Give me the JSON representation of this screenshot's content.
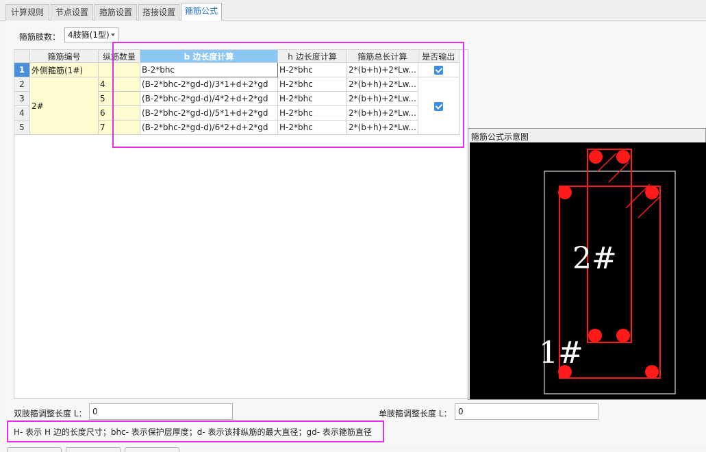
{
  "tabs": [
    {
      "label": "计算规则"
    },
    {
      "label": "节点设置"
    },
    {
      "label": "箍筋设置"
    },
    {
      "label": "搭接设置"
    },
    {
      "label": "箍筋公式"
    }
  ],
  "stirrup_legs": {
    "label": "箍筋肢数：",
    "value": "4肢箍(1型)"
  },
  "table": {
    "headers": [
      "箍筋编号",
      "纵筋数量",
      "b 边长度计算",
      "h 边长度计算",
      "箍筋总长计算",
      "是否输出"
    ],
    "row_numbers": [
      "1",
      "2",
      "3",
      "4",
      "5"
    ],
    "rows": [
      {
        "id": "外侧箍筋(1#)",
        "count": "",
        "b": "B-2*bhc",
        "h": "H-2*bhc",
        "total": "2*(b+h)+2*Lw..."
      },
      {
        "id": "2#",
        "count": "4",
        "b": "(B-2*bhc-2*gd-d)/3*1+d+2*gd",
        "h": "H-2*bhc",
        "total": "2*(b+h)+2*Lw..."
      },
      {
        "id": "",
        "count": "5",
        "b": "(B-2*bhc-2*gd-d)/4*2+d+2*gd",
        "h": "H-2*bhc",
        "total": "2*(b+h)+2*Lw..."
      },
      {
        "id": "",
        "count": "6",
        "b": "(B-2*bhc-2*gd-d)/5*1+d+2*gd",
        "h": "H-2*bhc",
        "total": "2*(b+h)+2*Lw..."
      },
      {
        "id": "",
        "count": "7",
        "b": "(B-2*bhc-2*gd-d)/6*2+d+2*gd",
        "h": "H-2*bhc",
        "total": "2*(b+h)+2*Lw..."
      }
    ]
  },
  "diagram": {
    "title": "箍筋公式示意图",
    "label_outer": "1#",
    "label_inner": "2#"
  },
  "double_leg": {
    "label": "双肢箍调整长度 L：",
    "value": "0"
  },
  "single_leg": {
    "label": "单肢箍调整长度 L：",
    "value": "0"
  },
  "legend": "H- 表示 H 边的长度尺寸；bhc- 表示保护层厚度；d- 表示该排纵筋的最大直径；gd- 表示箍筋直径",
  "colors": {
    "accent": "#1e6fc7",
    "highlight": "#e52fe5",
    "rebar": "#ff1a1a",
    "cell_yellow": "#fdfbd0"
  }
}
